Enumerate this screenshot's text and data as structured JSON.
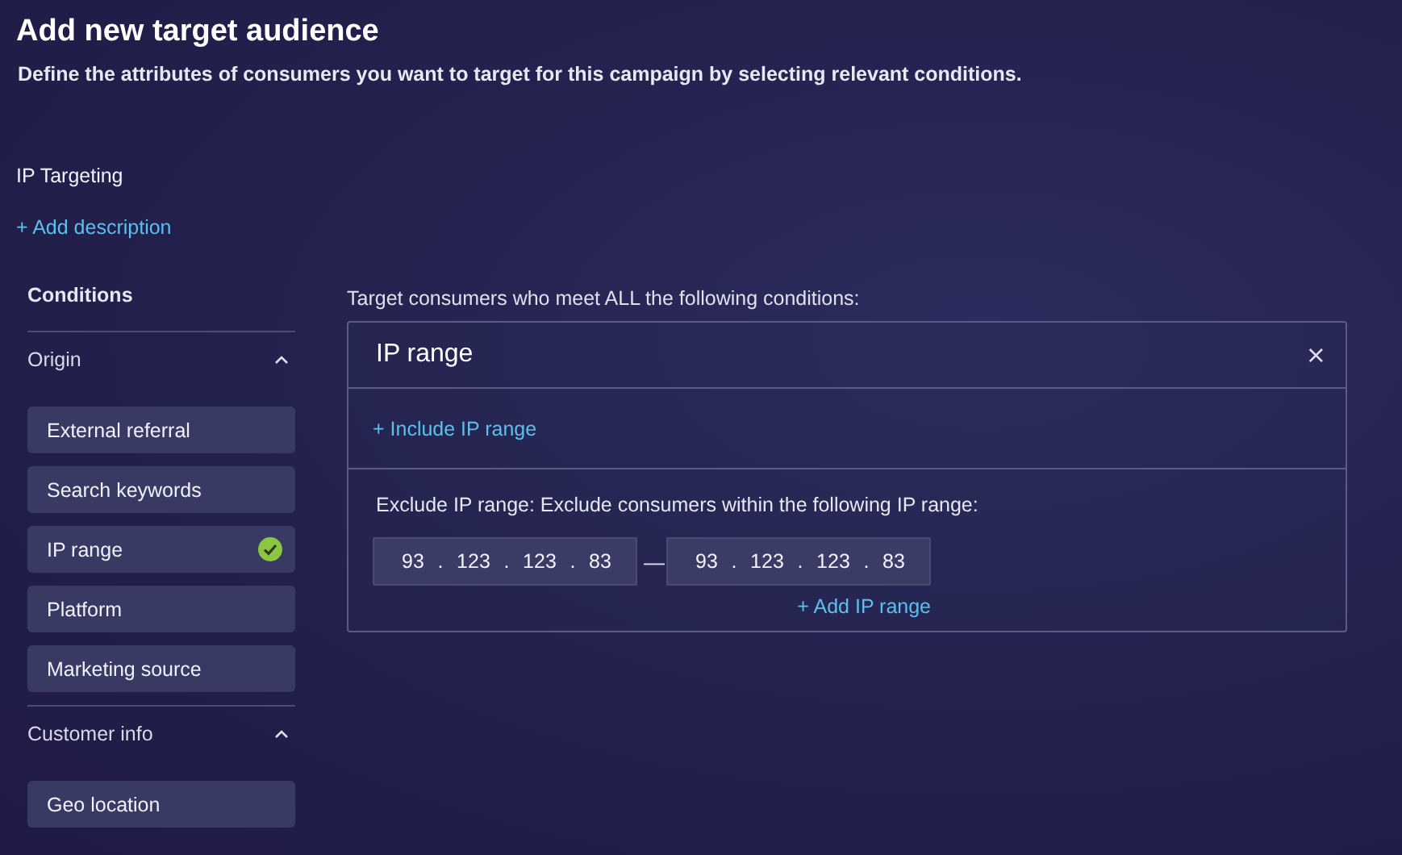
{
  "header": {
    "title": "Add new target audience",
    "subtitle": "Define the attributes of consumers you want to target for this campaign by selecting relevant conditions."
  },
  "audience": {
    "name": "IP Targeting",
    "add_description": "+ Add description"
  },
  "sidebar": {
    "title": "Conditions",
    "groups": [
      {
        "label": "Origin",
        "expanded": true,
        "items": [
          {
            "label": "External referral",
            "checked": false
          },
          {
            "label": "Search keywords",
            "checked": false
          },
          {
            "label": "IP range",
            "checked": true
          },
          {
            "label": "Platform",
            "checked": false
          },
          {
            "label": "Marketing source",
            "checked": false
          }
        ]
      },
      {
        "label": "Customer info",
        "expanded": true,
        "items": [
          {
            "label": "Geo location",
            "checked": false
          }
        ]
      }
    ]
  },
  "conditions": {
    "intro": "Target consumers who meet ALL the following conditions:",
    "card": {
      "title": "IP range",
      "close": "×",
      "include_link": "+ Include IP range",
      "exclude_label": "Exclude IP range: Exclude consumers within the following IP range:",
      "ranges": [
        {
          "from": [
            "93",
            "123",
            "123",
            "83"
          ],
          "to": [
            "93",
            "123",
            "123",
            "83"
          ]
        }
      ],
      "octet_separator": ".",
      "range_separator": "—",
      "add_range": "+ Add IP range"
    }
  }
}
